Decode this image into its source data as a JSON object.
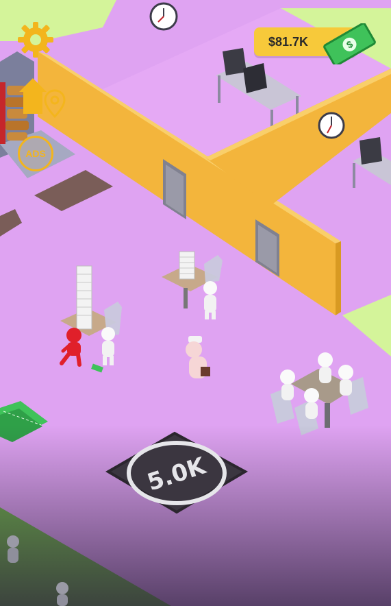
{
  "hud": {
    "money": "$81.7K",
    "icons": {
      "settings": "gear-icon",
      "home": "home-icon",
      "location": "location-pin-icon",
      "ads": "ads-icon",
      "cash": "cash-icon"
    },
    "ads_label": "ADS"
  },
  "buy_zone": {
    "cost_label": "5.0K"
  },
  "colors": {
    "floor": "#dfa3f2",
    "grass": "#d6f59a",
    "wall": "#f5b53c",
    "accent": "#f7c93a",
    "player": "#e0202a",
    "cash": "#3fc25a"
  }
}
